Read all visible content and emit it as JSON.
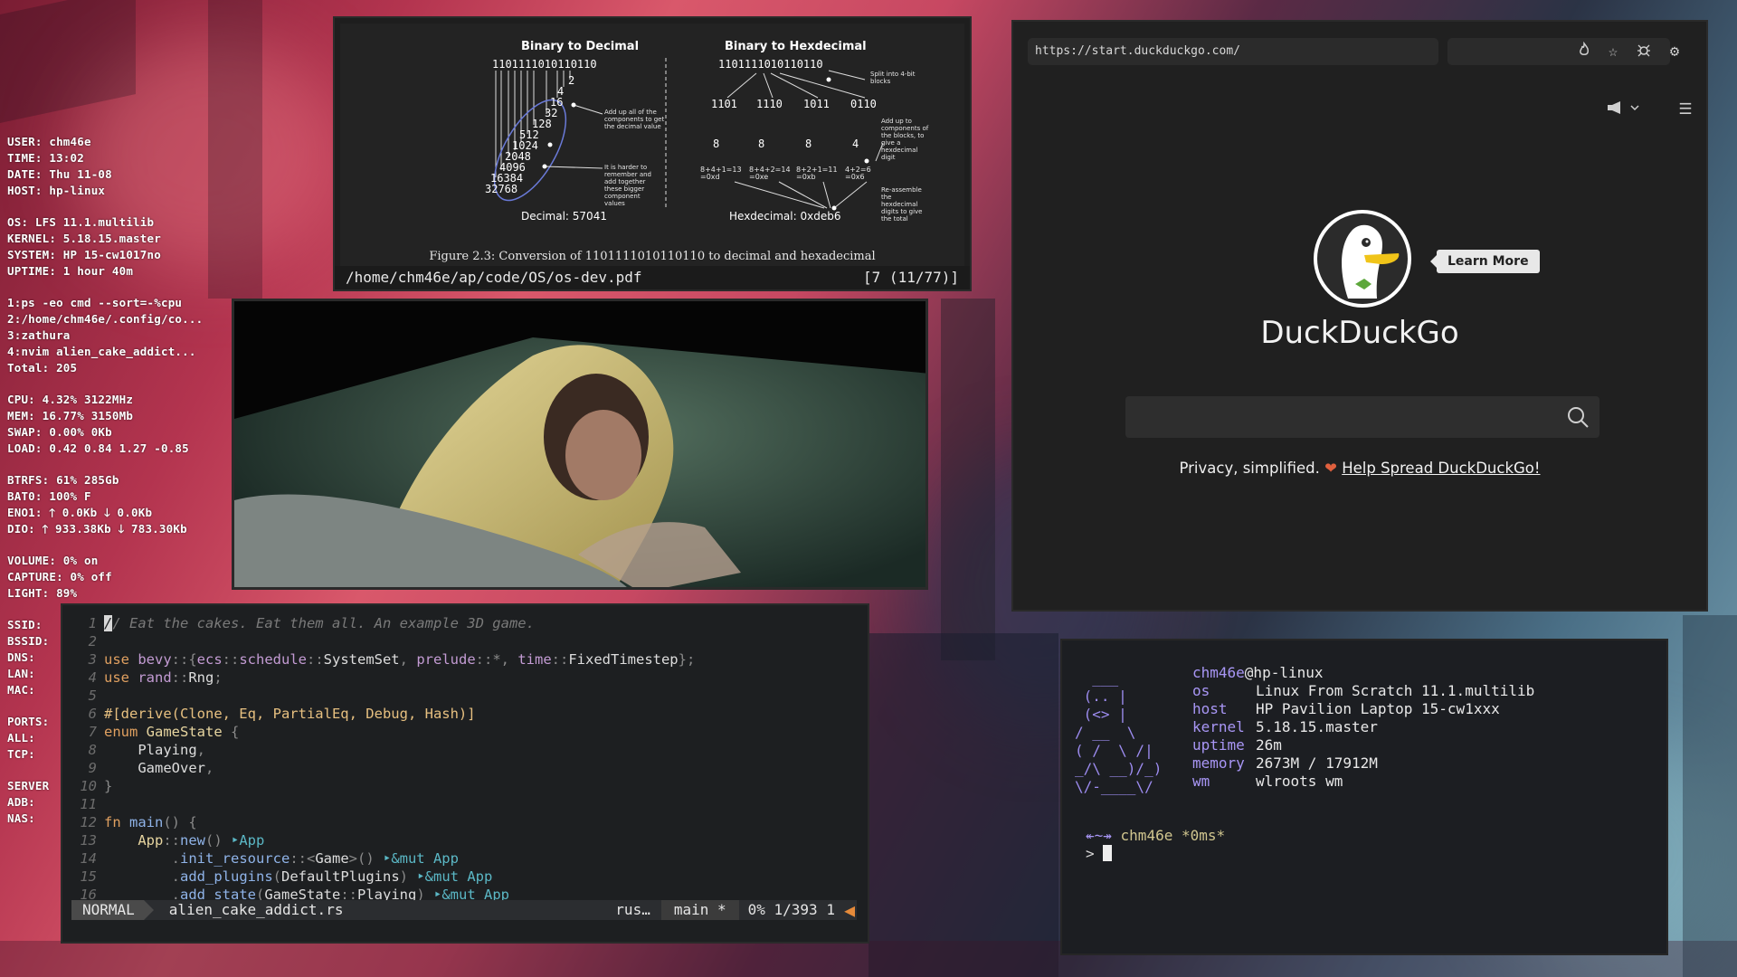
{
  "conky": {
    "blocks": [
      [
        "USER: chm46e",
        "TIME: 13:02",
        "DATE: Thu 11-08",
        "HOST: hp-linux"
      ],
      [
        "OS: LFS 11.1.multilib",
        "KERNEL: 5.18.15.master",
        "SYSTEM: HP 15-cw1017no",
        "UPTIME: 1 hour 40m"
      ],
      [
        "1:ps -eo cmd --sort=-%cpu",
        "2:/home/chm46e/.config/co...",
        "3:zathura",
        "4:nvim alien_cake_addict...",
        "Total: 205"
      ],
      [
        "CPU: 4.32% 3122MHz",
        "MEM: 16.77% 3150Mb",
        "SWAP: 0.00% 0Kb",
        "LOAD: 0.42 0.84 1.27 -0.85"
      ],
      [
        "BTRFS: 61% 285Gb",
        "BAT0: 100% F",
        "ENO1: 🡑 0.0Kb 🡓 0.0Kb",
        "DIO: 🡑 933.38Kb 🡓 783.30Kb"
      ],
      [
        "VOLUME: 0% on",
        "CAPTURE: 0% off",
        "LIGHT: 89%"
      ],
      [
        "SSID:",
        "BSSID:",
        "DNS:",
        "LAN:",
        "MAC:"
      ],
      [
        "PORTS:",
        "ALL:",
        "TCP:"
      ],
      [
        "SERVER",
        "ADB:",
        "NAS:"
      ]
    ]
  },
  "pdf": {
    "path": "/home/chm46e/ap/code/OS/os-dev.pdf",
    "page_info": "[7 (11/77)]",
    "left_title": "Binary to Decimal",
    "right_title": "Binary to Hexdecimal",
    "binary": "1101111010110110",
    "powers": [
      "2",
      "4",
      "16",
      "32",
      "128",
      "512",
      "1024",
      "2048",
      "4096",
      "16384",
      "32768"
    ],
    "decimal_result": "Decimal: 57041",
    "add_note": "Add up all of the components to get the decimal value",
    "harder_note": "It is harder to remember and add together these bigger component values",
    "split_note": "Split into 4-bit blocks",
    "nibbles": [
      "1101",
      "1110",
      "1011",
      "0110"
    ],
    "nibble_values": [
      "8",
      "8",
      "8",
      "4"
    ],
    "sums": [
      "8+4+1=13 =0xd",
      "8+4+2=14 =0xe",
      "8+2+1=11 =0xb",
      "4+2=6 =0x6"
    ],
    "hex_note": "Add up to components of the blocks, to give a hexdecimal digit",
    "reassemble_note": "Re-assemble the hexdecimal digits to give the total",
    "hex_result": "Hexdecimal: 0xdeb6",
    "caption": "Figure 2.3:   Conversion of 1101111010110110 to decimal and hexadecimal"
  },
  "editor": {
    "lines": [
      [
        [
          "c-com",
          "// Eat the cakes. Eat them all. An example 3D game."
        ]
      ],
      [],
      [
        [
          "c-kw",
          "use "
        ],
        [
          "c-ns",
          "bevy"
        ],
        [
          "c-pn",
          "::{"
        ],
        [
          "c-ns",
          "ecs"
        ],
        [
          "c-pn",
          "::"
        ],
        [
          "c-ns",
          "schedule"
        ],
        [
          "c-pn",
          "::"
        ],
        [
          "",
          "SystemSet"
        ],
        [
          "c-pn",
          ", "
        ],
        [
          "c-ns",
          "prelude"
        ],
        [
          "c-pn",
          "::*, "
        ],
        [
          "c-ns",
          "time"
        ],
        [
          "c-pn",
          "::"
        ],
        [
          "",
          "FixedTimestep"
        ],
        [
          "c-pn",
          "};"
        ]
      ],
      [
        [
          "c-kw",
          "use "
        ],
        [
          "c-ns",
          "rand"
        ],
        [
          "c-pn",
          "::"
        ],
        [
          "",
          "Rng"
        ],
        [
          "c-pn",
          ";"
        ]
      ],
      [],
      [
        [
          "c-attr",
          "#[derive(Clone, Eq, PartialEq, Debug, Hash)]"
        ]
      ],
      [
        [
          "c-kw",
          "enum "
        ],
        [
          "c-ty",
          "GameState "
        ],
        [
          "c-pn",
          "{"
        ]
      ],
      [
        [
          "",
          "    Playing"
        ],
        [
          "c-pn",
          ","
        ]
      ],
      [
        [
          "",
          "    GameOver"
        ],
        [
          "c-pn",
          ","
        ]
      ],
      [
        [
          "c-pn",
          "}"
        ]
      ],
      [],
      [
        [
          "c-kw",
          "fn "
        ],
        [
          "c-fn",
          "main"
        ],
        [
          "c-pn",
          "() {"
        ]
      ],
      [
        [
          "",
          "    "
        ],
        [
          "c-ty",
          "App"
        ],
        [
          "c-pn",
          "::"
        ],
        [
          "c-fn",
          "new"
        ],
        [
          "c-pn",
          "() "
        ],
        [
          "c-hint",
          "‣App"
        ]
      ],
      [
        [
          "",
          "        "
        ],
        [
          "c-pn",
          "."
        ],
        [
          "c-fn",
          "init_resource"
        ],
        [
          "c-pn",
          "::<"
        ],
        [
          "",
          "Game"
        ],
        [
          "c-pn",
          ">() "
        ],
        [
          "c-hint",
          "‣&mut App"
        ]
      ],
      [
        [
          "",
          "        "
        ],
        [
          "c-pn",
          "."
        ],
        [
          "c-fn",
          "add_plugins"
        ],
        [
          "c-pn",
          "("
        ],
        [
          "",
          "DefaultPlugins"
        ],
        [
          "c-pn",
          ") "
        ],
        [
          "c-hint",
          "‣&mut App"
        ]
      ],
      [
        [
          "",
          "        "
        ],
        [
          "c-pn",
          "."
        ],
        [
          "c-fn",
          "add_state"
        ],
        [
          "c-pn",
          "("
        ],
        [
          "",
          "GameState"
        ],
        [
          "c-pn",
          "::"
        ],
        [
          "",
          "Playing"
        ],
        [
          "c-pn",
          ") "
        ],
        [
          "c-hint",
          "‣&mut App"
        ]
      ]
    ],
    "mode": "NORMAL",
    "filename": "alien_cake_addict.rs",
    "filetype": "rus…",
    "branch": "main *",
    "position": "0% 1/393 1"
  },
  "browser": {
    "url": "https://start.duckduckgo.com/",
    "learn_more": "Learn More",
    "brand": "DuckDuckGo",
    "tagline": "Privacy, simplified.",
    "help_link": "Help Spread DuckDuckGo!"
  },
  "terminal": {
    "ascii": "  ___\n (.. |\n (<> |\n/ __  \\\n( /  \\ /|\n_/\\ __)/_)\n\\/-____\\/",
    "user": "chm46e",
    "at_host": "@hp-linux",
    "rows": [
      {
        "k": "os",
        "v": "Linux From Scratch 11.1.multilib"
      },
      {
        "k": "host",
        "v": "HP Pavilion Laptop 15-cw1xxx"
      },
      {
        "k": "kernel",
        "v": "5.18.15.master"
      },
      {
        "k": "uptime",
        "v": "26m"
      },
      {
        "k": "memory",
        "v": "2673M / 17912M"
      },
      {
        "k": "wm",
        "v": "wlroots wm"
      }
    ],
    "prompt_arrow": "↞~↠",
    "prompt_user": " chm46e",
    "prompt_time": " *0ms*",
    "prompt_char": "> "
  }
}
